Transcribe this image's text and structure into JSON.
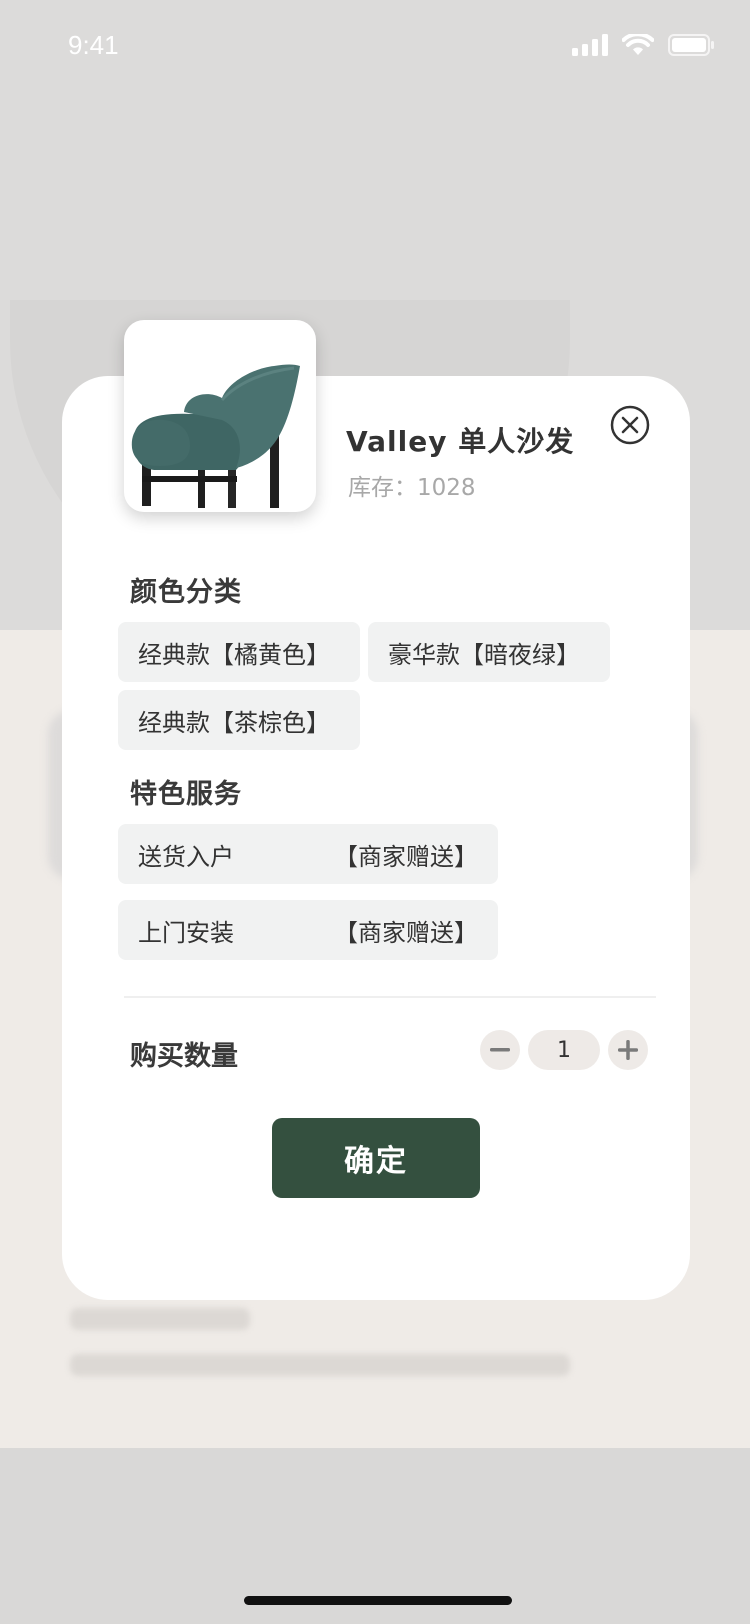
{
  "status_bar": {
    "time": "9:41"
  },
  "product": {
    "title": "Valley 单人沙发",
    "stock": "库存：1028",
    "image": "armchair-image"
  },
  "sections": {
    "color_title": "颜色分类",
    "service_title": "特色服务",
    "quantity_title": "购买数量"
  },
  "colors": [
    "经典款【橘黄色】",
    "豪华款【暗夜绿】",
    "经典款【茶棕色】"
  ],
  "services": [
    {
      "name": "送货入户",
      "note": "【商家赠送】"
    },
    {
      "name": "上门安装",
      "note": "【商家赠送】"
    }
  ],
  "quantity": {
    "minus": "−",
    "value": "1",
    "plus": "+"
  },
  "confirm_label": "确定",
  "theme": {
    "accent": "#34503f",
    "chip_bg": "#f1f2f2"
  }
}
